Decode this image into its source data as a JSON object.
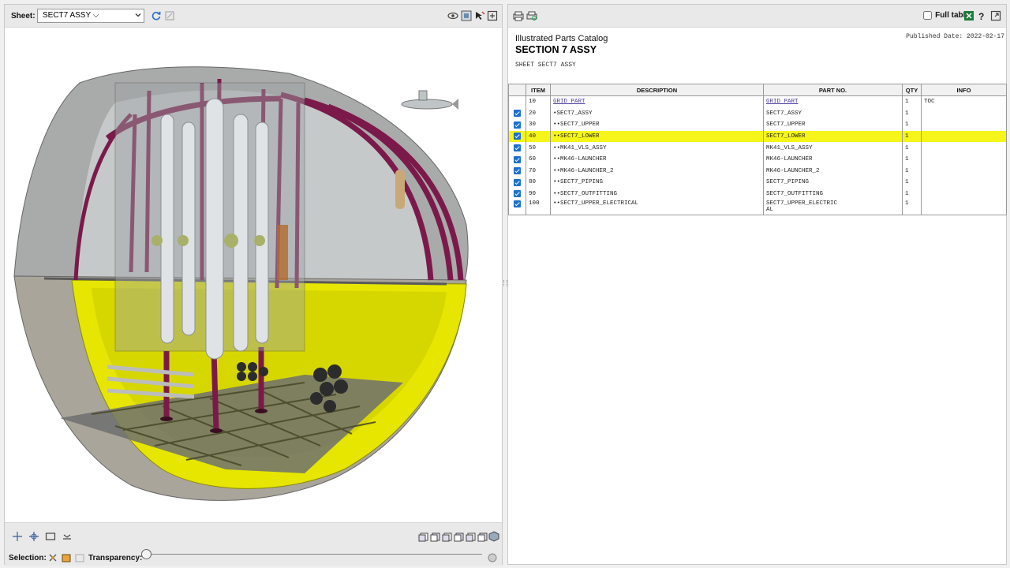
{
  "left_toolbar": {
    "sheet_label": "Sheet:",
    "sheet_value": "SECT7 ASSY",
    "icons": [
      "refresh-icon",
      "fit-view-icon",
      "hide-icon",
      "explode-icon",
      "cursor-icon",
      "fullscreen-icon"
    ]
  },
  "bottom_bar": {
    "selection_label": "Selection:",
    "transparency_label": "Transparency:",
    "transparency_level": 0,
    "view_icons": [
      "view-front-icon",
      "view-back-icon",
      "view-left-icon",
      "view-right-icon",
      "view-top-icon",
      "view-bottom-icon",
      "view-iso-icon"
    ]
  },
  "right_toolbar": {
    "full_table_label": "Full table",
    "full_table_checked": false
  },
  "catalog": {
    "title": "Illustrated Parts Catalog",
    "section": "SECTION 7 ASSY",
    "sheet_line": "SHEET SECT7 ASSY",
    "published": "Published Date: 2022-02-17"
  },
  "table": {
    "headers": [
      "ITEM",
      "DESCRIPTION",
      "PART NO.",
      "QTY",
      "INFO"
    ],
    "rows": [
      {
        "checked": false,
        "item": "10",
        "desc": "GRID PART",
        "part": "GRID PART",
        "qty": "1",
        "info": "TOC",
        "link": true
      },
      {
        "checked": true,
        "item": "20",
        "desc": "•SECT7_ASSY",
        "part": "SECT7_ASSY",
        "qty": "1",
        "info": ""
      },
      {
        "checked": true,
        "item": "30",
        "desc": "••SECT7_UPPER",
        "part": "SECT7_UPPER",
        "qty": "1",
        "info": ""
      },
      {
        "checked": true,
        "item": "40",
        "desc": "••SECT7_LOWER",
        "part": "SECT7_LOWER",
        "qty": "1",
        "info": "",
        "highlight": true
      },
      {
        "checked": true,
        "item": "50",
        "desc": "••MK41_VLS_ASSY",
        "part": "MK41_VLS_ASSY",
        "qty": "1",
        "info": ""
      },
      {
        "checked": true,
        "item": "60",
        "desc": "••MK46-LAUNCHER",
        "part": "MK46-LAUNCHER",
        "qty": "1",
        "info": ""
      },
      {
        "checked": true,
        "item": "70",
        "desc": "••MK46-LAUNCHER_2",
        "part": "MK46-LAUNCHER_2",
        "qty": "1",
        "info": ""
      },
      {
        "checked": true,
        "item": "80",
        "desc": "••SECT7_PIPING",
        "part": "SECT7_PIPING",
        "qty": "1",
        "info": ""
      },
      {
        "checked": true,
        "item": "90",
        "desc": "••SECT7_OUTFITTING",
        "part": "SECT7_OUTFITTING",
        "qty": "1",
        "info": ""
      },
      {
        "checked": true,
        "item": "100",
        "desc": "••SECT7_UPPER_ELECTRICAL",
        "part": "SECT7_UPPER_ELECTRIC\nAL",
        "qty": "1",
        "info": ""
      }
    ]
  },
  "colors": {
    "highlight": "#f5f51a",
    "hull_yellow": "#e6e600",
    "frame_maroon": "#7b1a4a",
    "hull_gray": "#9a9a9a"
  }
}
